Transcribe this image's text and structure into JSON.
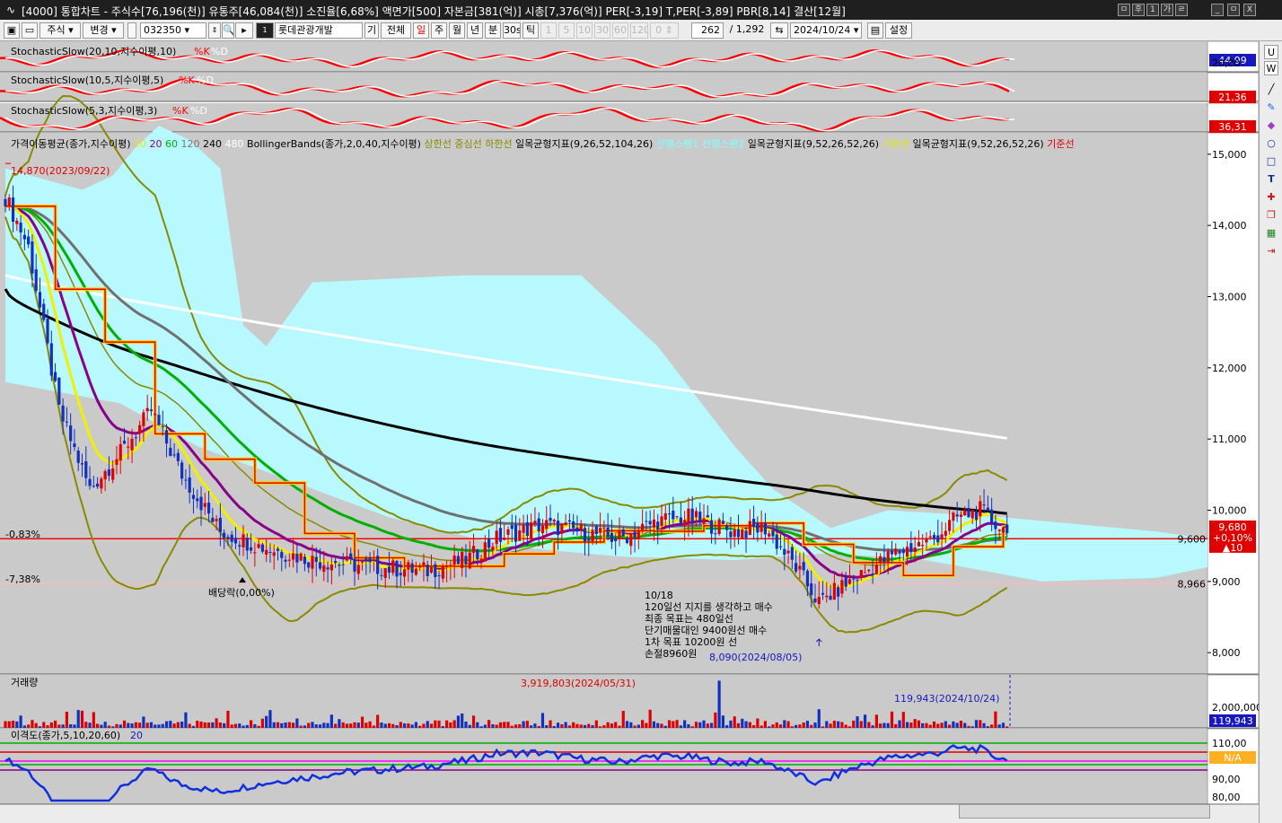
{
  "window": {
    "title": "[4000] 통합차트 - 주식수[76,196(천)] 유통주[46,084(천)] 소진율[6,68%] 액면가[500] 자본금[381(억)] 시총[7,376(억)] PER[-3,19] T,PER[-3,89] PBR[8,14] 결산[12월]",
    "buttons": [
      "ㅁ",
      "후",
      "1",
      "가",
      "ㄹ",
      "_",
      "ㅁ",
      "X"
    ]
  },
  "toolbar": {
    "market": "주식",
    "change": "변경",
    "code": "032350",
    "stock_name": "롯데관광개발",
    "btn_gi": "기",
    "btn_all": "전체",
    "periods": [
      "일",
      "주",
      "월",
      "년",
      "분",
      "30s",
      "틱"
    ],
    "intervals": [
      "1",
      "5",
      "10",
      "30",
      "60",
      "120"
    ],
    "count_a": "0",
    "count_b": "262",
    "total": "/ 1,292",
    "date": "2024/10/24",
    "settings": "설정"
  },
  "panels": {
    "stoch1": {
      "label": "StochasticSlow(20,10,지수이평,10)",
      "k": "%K",
      "d": "%D",
      "value": "44,99",
      "scale": "20,00"
    },
    "stoch2": {
      "label": "StochasticSlow(10,5,지수이평,5)",
      "k": "%K",
      "d": "%D",
      "value": "21,36"
    },
    "stoch3": {
      "label": "StochasticSlow(5,3,지수이평,3)",
      "k": "%K",
      "d": "%D",
      "value": "36,31"
    },
    "price": {
      "legend": [
        {
          "text": "가격이동평균(종가,지수이평)",
          "color": "#000000"
        },
        {
          "text": "10",
          "color": "#e8e800"
        },
        {
          "text": "20",
          "color": "#8a008a"
        },
        {
          "text": "60",
          "color": "#00b000"
        },
        {
          "text": "120",
          "color": "#7a7a7a"
        },
        {
          "text": "240",
          "color": "#000000"
        },
        {
          "text": "480",
          "color": "#ffffff"
        },
        {
          "text": "BollingerBands(종가,2,0,40,지수이평)",
          "color": "#000000"
        },
        {
          "text": "상한선",
          "color": "#8a8a00"
        },
        {
          "text": "중심선",
          "color": "#8a8a00"
        },
        {
          "text": "하한선",
          "color": "#8a8a00"
        },
        {
          "text": "일목균형지표(9,26,52,104,26)",
          "color": "#000000"
        },
        {
          "text": "선행스팬1",
          "color": "#7fffff"
        },
        {
          "text": "선행스팬2",
          "color": "#7fffff"
        },
        {
          "text": "일목균형지표(9,52,26,52,26)",
          "color": "#000000"
        },
        {
          "text": "기준선",
          "color": "#e8e800"
        },
        {
          "text": "일목균형지표(9,52,26,52,26)",
          "color": "#000000"
        },
        {
          "text": "기준선",
          "color": "#e00000"
        }
      ],
      "y_ticks": [
        "15,000",
        "14,000",
        "13,000",
        "12,000",
        "11,000",
        "10,000",
        "9,000",
        "8,000"
      ],
      "high_label": "14,870(2023/09/22)",
      "low_label": "8,090(2024/08/05)",
      "pct_top": "-0,83%",
      "pct_bottom": "-7,38%",
      "dividend": "배당락(0,00%)",
      "level_red": "9,600",
      "level_pink": "8,966",
      "current_price": "9,680",
      "current_change": "+0,10%",
      "current_diff": "▲10",
      "memo": [
        "10/18",
        "120일선 지지를 생각하고 매수",
        "최종 목표는 480일선",
        "단기매물대인 9400원선 매수",
        "1차 목표 10200원 선",
        "손절8960원"
      ]
    },
    "volume": {
      "label": "거래량",
      "max_label": "3,919,803(2024/05/31)",
      "last_label": "119,943(2024/10/24)",
      "scale": "2,000,000",
      "value": "119,943"
    },
    "disparity": {
      "label": "이격도(종가,5,10,20,60)",
      "period": "20",
      "ticks": [
        "110,00",
        "90,00",
        "80,00"
      ],
      "value": "N/A"
    }
  },
  "chart_data": {
    "type": "candlestick",
    "ylim": [
      7700,
      15300
    ],
    "high": 14870,
    "low": 8090,
    "last_close": 9680,
    "ma_last": {
      "ma10": 9750,
      "ma20": 9710,
      "ma60": 9650,
      "ma120": 9600,
      "ma240": 10010,
      "ma480": 11010
    },
    "bollinger_last": {
      "upper": 10310,
      "middle": 9690,
      "lower": 9000
    },
    "max_volume": 3919803,
    "last_volume": 119943
  }
}
